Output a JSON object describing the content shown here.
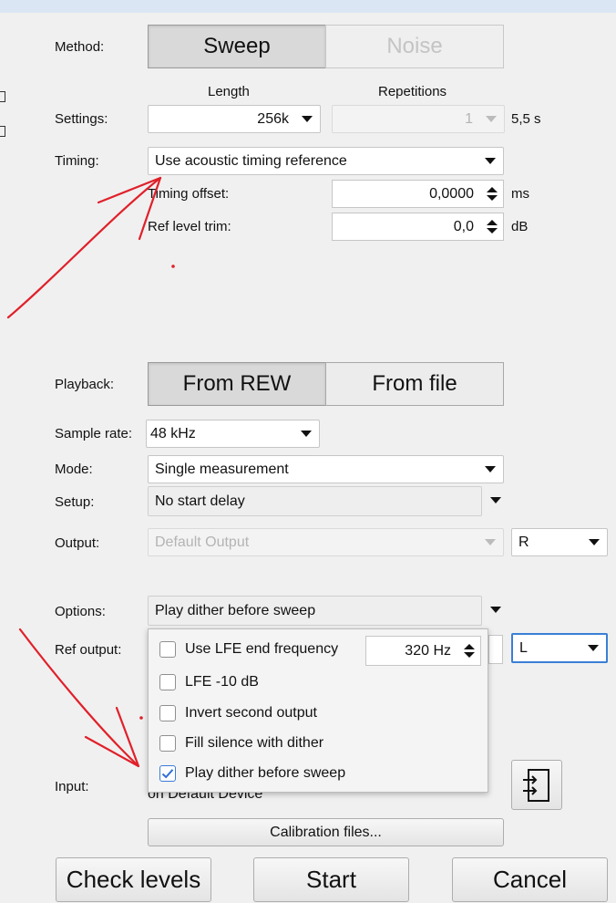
{
  "method": {
    "label": "Method:",
    "options": [
      "Sweep",
      "Noise"
    ],
    "selected": "Sweep"
  },
  "settings": {
    "label": "Settings:",
    "length_header": "Length",
    "repetitions_header": "Repetitions",
    "length_value": "256k",
    "repetitions_value": "1",
    "duration": "5,5 s"
  },
  "timing": {
    "label": "Timing:",
    "value": "Use acoustic timing reference",
    "offset_label": "Timing offset:",
    "offset_value": "0,0000",
    "offset_unit": "ms",
    "trim_label": "Ref level trim:",
    "trim_value": "0,0",
    "trim_unit": "dB"
  },
  "playback": {
    "label": "Playback:",
    "options": [
      "From REW",
      "From file"
    ],
    "selected": "From REW"
  },
  "sample_rate": {
    "label": "Sample rate:",
    "value": "48 kHz"
  },
  "mode": {
    "label": "Mode:",
    "value": "Single measurement"
  },
  "setup": {
    "label": "Setup:",
    "value": "No start delay"
  },
  "output": {
    "label": "Output:",
    "value": "Default Output",
    "channel": "R"
  },
  "options": {
    "label": "Options:",
    "value": "Play dither before sweep"
  },
  "ref_output": {
    "label": "Ref output:",
    "channel": "L"
  },
  "options_popup": {
    "items": [
      {
        "label": "Use LFE end frequency",
        "checked": false
      },
      {
        "label": "LFE -10 dB",
        "checked": false
      },
      {
        "label": "Invert second output",
        "checked": false
      },
      {
        "label": "Fill silence with dither",
        "checked": false
      },
      {
        "label": "Play dither before sweep",
        "checked": true
      }
    ],
    "lfe_freq": "320 Hz"
  },
  "input": {
    "label": "Input:",
    "device": "on Default Device"
  },
  "calibration_button": "Calibration files...",
  "buttons": {
    "check_levels": "Check levels",
    "start": "Start",
    "cancel": "Cancel"
  },
  "colors": {
    "annotation_red": "#e0202a",
    "check_blue": "#2f6fd6",
    "focus_blue": "#3a7fd5"
  }
}
